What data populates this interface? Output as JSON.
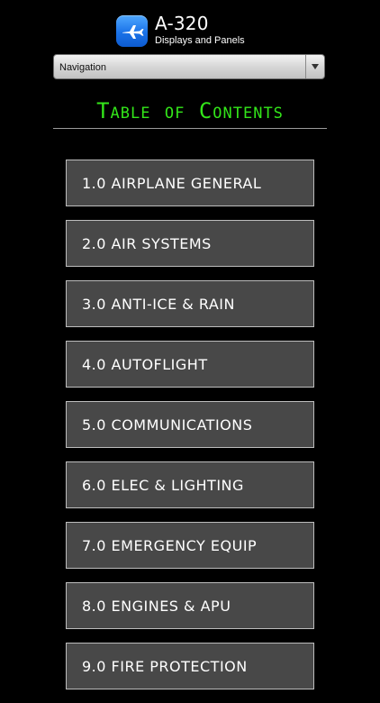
{
  "header": {
    "app_title": "A-320",
    "app_subtitle": "Displays and Panels",
    "icon": "airplane-icon",
    "icon_color": "#1a72e8"
  },
  "nav_select": {
    "selected": "Navigation",
    "icon": "chevron-down-icon"
  },
  "toc": {
    "title": "Table of Contents",
    "title_color": "#33e61a",
    "items": [
      {
        "label": "1.0 AIRPLANE GENERAL"
      },
      {
        "label": "2.0 AIR SYSTEMS"
      },
      {
        "label": "3.0 ANTI-ICE & RAIN"
      },
      {
        "label": "4.0 AUTOFLIGHT"
      },
      {
        "label": "5.0 COMMUNICATIONS"
      },
      {
        "label": "6.0 ELEC & LIGHTING"
      },
      {
        "label": "7.0 EMERGENCY EQUIP"
      },
      {
        "label": "8.0 ENGINES & APU"
      },
      {
        "label": "9.0 FIRE PROTECTION"
      }
    ]
  }
}
